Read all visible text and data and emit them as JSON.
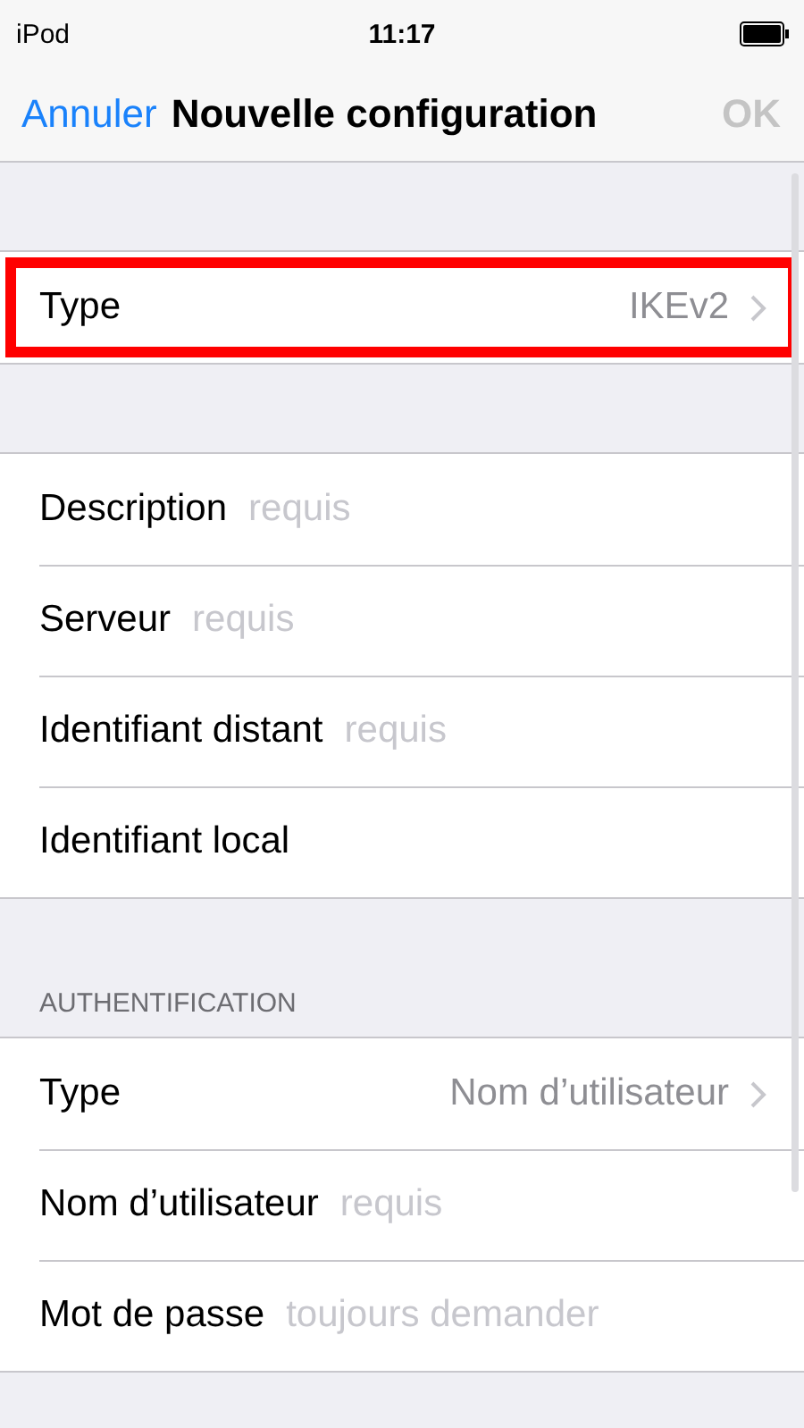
{
  "status_bar": {
    "device": "iPod",
    "time": "11:17"
  },
  "nav": {
    "cancel": "Annuler",
    "title": "Nouvelle configuration",
    "done": "OK",
    "done_disabled": true
  },
  "sections": [
    {
      "rows": [
        {
          "kind": "value",
          "label": "Type",
          "value": "IKEv2",
          "highlighted": true
        }
      ]
    },
    {
      "rows": [
        {
          "kind": "field",
          "label": "Description",
          "placeholder": "requis"
        },
        {
          "kind": "field",
          "label": "Serveur",
          "placeholder": "requis"
        },
        {
          "kind": "field",
          "label": "Identifiant distant",
          "placeholder": "requis"
        },
        {
          "kind": "field",
          "label": "Identifiant local"
        }
      ]
    },
    {
      "header": "AUTHENTIFICATION",
      "rows": [
        {
          "kind": "value",
          "label": "Type",
          "value": "Nom d’utilisateur",
          "highlighted": false
        },
        {
          "kind": "field",
          "label": "Nom d’utilisateur",
          "placeholder": "requis"
        },
        {
          "kind": "field",
          "label": "Mot de passe",
          "placeholder": "toujours demander"
        }
      ]
    }
  ]
}
